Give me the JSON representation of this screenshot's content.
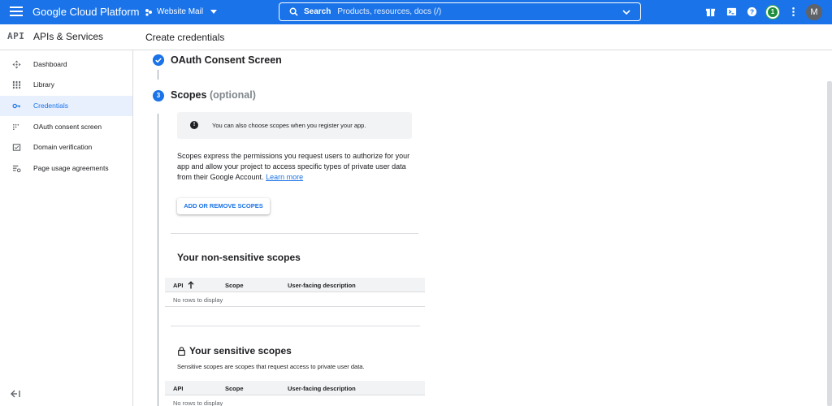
{
  "topbar": {
    "brand": "Google Cloud Platform",
    "project": "Website Mail",
    "search_label": "Search",
    "search_placeholder": "Products, resources, docs (/)",
    "notification_count": "1",
    "avatar_initial": "M"
  },
  "header": {
    "api_logo": "API",
    "api_title": "APIs & Services",
    "page_title": "Create credentials"
  },
  "sidebar": {
    "items": [
      {
        "label": "Dashboard",
        "icon": "dashboard-icon",
        "active": false
      },
      {
        "label": "Library",
        "icon": "library-icon",
        "active": false
      },
      {
        "label": "Credentials",
        "icon": "key-icon",
        "active": true
      },
      {
        "label": "OAuth consent screen",
        "icon": "consent-icon",
        "active": false
      },
      {
        "label": "Domain verification",
        "icon": "domain-icon",
        "active": false
      },
      {
        "label": "Page usage agreements",
        "icon": "settings-list-icon",
        "active": false
      }
    ]
  },
  "steps": {
    "step1_title": "OAuth Consent Screen",
    "step2_number": "3",
    "step2_title": "Scopes",
    "step2_optional": "(optional)"
  },
  "info": {
    "text": "You can also choose scopes when you register your app."
  },
  "description": {
    "text": "Scopes express the permissions you request users to authorize for your app and allow your project to access specific types of private user data from their Google Account.",
    "link": "Learn more"
  },
  "add_scopes_button": "ADD OR REMOVE SCOPES",
  "non_sensitive": {
    "title": "Your non-sensitive scopes",
    "columns": [
      "API",
      "Scope",
      "User-facing description"
    ],
    "empty": "No rows to display"
  },
  "sensitive": {
    "title": "Your sensitive scopes",
    "description": "Sensitive scopes are scopes that request access to private user data.",
    "columns": [
      "API",
      "Scope",
      "User-facing description"
    ],
    "empty": "No rows to display"
  },
  "colors": {
    "primary": "#1a73e8",
    "active_bg": "#e8f0fe",
    "badge_green": "#1e8e3e"
  }
}
